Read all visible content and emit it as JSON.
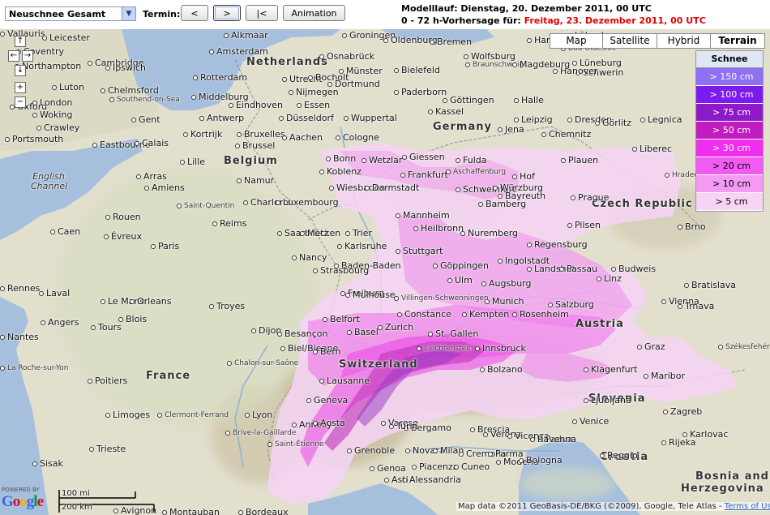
{
  "toolbar": {
    "product_select": "Neuschnee Gesamt",
    "termin_label": "Termin:",
    "btn_prev": "<",
    "btn_next": ">",
    "btn_first": "|<",
    "btn_animation": "Animation",
    "run_line": "Modelllauf: Dienstag, 20. Dezember 2011, 00 UTC",
    "forecast_prefix": "0 - 72 h-Vorhersage für:",
    "forecast_date": "Freitag, 23. Dezember 2011, 00 UTC"
  },
  "map_types": [
    "Map",
    "Satellite",
    "Hybrid",
    "Terrain"
  ],
  "map_type_selected": "Terrain",
  "nav": {
    "up": "↑",
    "left": "←",
    "right": "→",
    "down": "↓",
    "zoom_in": "+",
    "zoom_out": "−"
  },
  "legend": {
    "title": "Schnee",
    "items": [
      {
        "label": "> 150 cm",
        "color": "#8f6ff2"
      },
      {
        "label": "> 100 cm",
        "color": "#7d1bef"
      },
      {
        "label": "> 75 cm",
        "color": "#8e1bc9"
      },
      {
        "label": "> 50 cm",
        "color": "#c01cc0"
      },
      {
        "label": "> 30 cm",
        "color": "#f02ef0"
      },
      {
        "label": "> 20 cm",
        "color": "#f25bf2"
      },
      {
        "label": "> 10 cm",
        "color": "#f39af3"
      },
      {
        "label": "> 5 cm",
        "color": "#f6d4f6"
      }
    ]
  },
  "countries": [
    {
      "name": "Netherlands"
    },
    {
      "name": "Belgium"
    },
    {
      "name": "Germany"
    },
    {
      "name": "France"
    },
    {
      "name": "Switzerland"
    },
    {
      "name": "Austria"
    },
    {
      "name": "Czech Republic"
    },
    {
      "name": "Slovenia"
    },
    {
      "name": "Croatia"
    },
    {
      "name": "Bosnia and"
    },
    {
      "name": "Herzegovina"
    }
  ],
  "seas": [
    {
      "name": "English\nChannel"
    }
  ],
  "cities": [
    "Leicester",
    "Coventry",
    "Cambridge",
    "Northampton",
    "Ipswich",
    "Luton",
    "Chelmsford",
    "Oxford",
    "Southend-on-Sea",
    "London",
    "Woking",
    "Crawley",
    "Portsmouth",
    "Eastbourne",
    "Calais",
    "Amsterdam",
    "Alkmaar",
    "Groningen",
    "Oldenburg",
    "Bremen",
    "Hamburg",
    "Lübeck",
    "Bad Oldesloe",
    "Lüneburg",
    "Schwerin",
    "Osnabrück",
    "Wolfsburg",
    "Hanover",
    "Braunschweig",
    "Magdeburg",
    "Rotterdam",
    "Utrecht",
    "Bocholt",
    "Münster",
    "Bielefeld",
    "Kassel",
    "Göttingen",
    "Halle",
    "Leipzig",
    "Dresden",
    "Middelburg",
    "Nijmegen",
    "Dortmund",
    "Paderborn",
    "Eindhoven",
    "Essen",
    "Düsseldorf",
    "Wuppertal",
    "Antwerp",
    "Gent",
    "Kortrijk",
    "Bruxelles",
    "Brussel",
    "Aachen",
    "Cologne",
    "Bonn",
    "Jena",
    "Chemnitz",
    "Görlitz",
    "Legnica",
    "Lille",
    "Arras",
    "Namur",
    "Koblenz",
    "Wetzlar",
    "Giessen",
    "Fulda",
    "Frankfurt",
    "Aschaffenburg",
    "Schweinfurt",
    "Würzburg",
    "Bamberg",
    "Bayreuth",
    "Hof",
    "Plauen",
    "Liberec",
    "Amiens",
    "Saint-Quentin",
    "Charleroi",
    "Luxembourg",
    "Wiesbaden",
    "Darmstadt",
    "Mannheim",
    "Prague",
    "Pilsen",
    "Hradec Králové",
    "Rouen",
    "Reims",
    "Saarbrücken",
    "Trier",
    "Heilbronn",
    "Nuremberg",
    "Regensburg",
    "Brno",
    "Caen",
    "Évreux",
    "Paris",
    "Metz",
    "Nancy",
    "Karlsruhe",
    "Baden-Baden",
    "Stuttgart",
    "Göppingen",
    "Ingolstadt",
    "Landshut",
    "Passau",
    "Budweis",
    "Strasbourg",
    "Freiburg",
    "Ulm",
    "Augsburg",
    "Munich",
    "Salzburg",
    "Linz",
    "Vienna",
    "Bratislava",
    "Trnava",
    "Rennes",
    "Laval",
    "Le Mans",
    "Orleans",
    "Blois",
    "Troyes",
    "Dijon",
    "Besançon",
    "Belfort",
    "Mulhouse",
    "Basel",
    "Zurich",
    "Constance",
    "Kempten",
    "Rosenheim",
    "St. Gallen",
    "Liechtenstein",
    "Innsbruck",
    "Villingen-Schwenningen",
    "Nantes",
    "Angers",
    "Tours",
    "Chalon-sur-Saône",
    "Biel/Bienne",
    "Bern",
    "Graz",
    "Maribor",
    "Székesfehérvár",
    "La Roche-sur-Yon",
    "Poitiers",
    "Lausanne",
    "Geneva",
    "Bolzano",
    "Klagenfurt",
    "Ljubljana",
    "Zagreb",
    "Limoges",
    "Clermont-Ferrand",
    "Lyon",
    "Annecy",
    "Aosta",
    "Varese",
    "Bergamo",
    "Brescia",
    "Verona",
    "Vicenza",
    "Padua",
    "Venice",
    "Trieste",
    "Brive-la-Gaillarde",
    "Saint-Étienne",
    "Grenoble",
    "Turin",
    "Novara",
    "Milan",
    "Cremona",
    "Parma",
    "Modena",
    "Bologna",
    "Ravenna",
    "Genoa",
    "Piacenza",
    "Alessandria",
    "Asti",
    "Cuneo",
    "Reggio",
    "Rijeka",
    "Karlovac",
    "Sisak",
    "Bordeaux",
    "Avignon",
    "Montauban",
    "Vallauris"
  ],
  "scale": {
    "mi": "100 mi",
    "km": "200 km"
  },
  "branding": {
    "powered": "POWERED BY",
    "google": "Google"
  },
  "attribution": {
    "text": "Map data ©2011 GeoBasis-DE/BKG (©2009), Google, Tele Atlas - ",
    "link": "Terms of Use"
  }
}
